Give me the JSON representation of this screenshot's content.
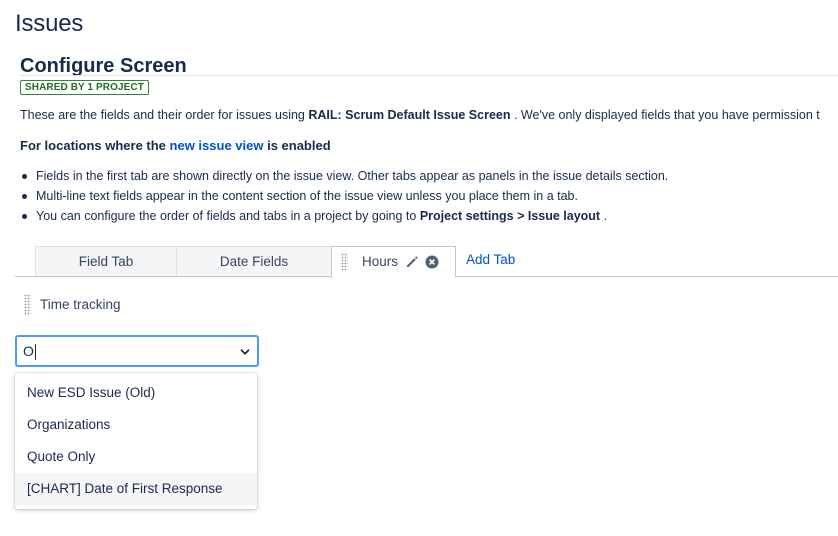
{
  "page": {
    "title": "Issues"
  },
  "screen": {
    "title": "Configure Screen",
    "shared_badge": "SHARED BY 1 PROJECT",
    "description": {
      "prefix": "These are the fields and their order for issues using ",
      "screen_name": "RAIL: Scrum Default Issue Screen",
      "suffix": " . We've only displayed fields that you have permission t"
    },
    "locations": {
      "prefix": "For locations where the ",
      "link": "new issue view",
      "suffix": " is enabled"
    },
    "bullets": {
      "b1": "Fields in the first tab are shown directly on the issue view. Other tabs appear as panels in the issue details section.",
      "b2": "Multi-line text fields appear in the content section of the issue view unless you place them in a tab.",
      "b3_prefix": "You can configure the order of fields and tabs in a project by going to ",
      "b3_bold": "Project settings > Issue layout",
      "b3_suffix": " ."
    }
  },
  "tabs": {
    "items": [
      "Field Tab",
      "Date Fields",
      "Hours"
    ],
    "active": "Hours",
    "add_label": "Add Tab"
  },
  "fields": [
    "Time tracking"
  ],
  "field_select": {
    "value": "O",
    "options": [
      "New ESD Issue (Old)",
      "Organizations",
      "Quote Only",
      "[CHART] Date of First Response"
    ],
    "highlighted": "[CHART] Date of First Response"
  },
  "colors": {
    "link": "#0052cc",
    "focus_border": "#4c9aff",
    "badge_green": "#216e1f",
    "text": "#172b4d"
  }
}
